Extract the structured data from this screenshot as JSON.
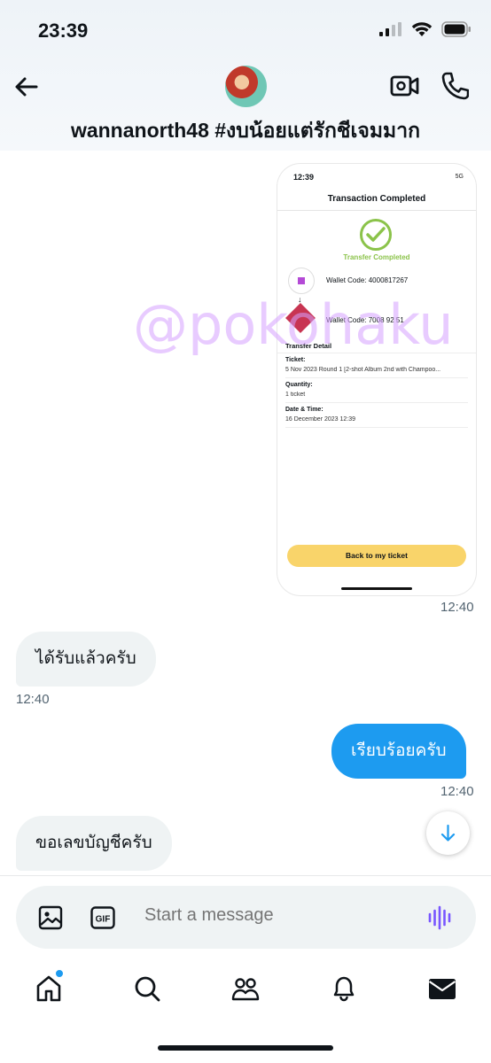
{
  "status_bar": {
    "time": "23:39"
  },
  "header": {
    "title": "wannanorth48 #งบน้อยแต่รักชีเจมมาก",
    "icons": {
      "back": "arrow-left-icon",
      "video": "video-call-icon",
      "call": "phone-icon"
    }
  },
  "shared_image": {
    "status_time": "12:39",
    "status_network": "5G",
    "title": "Transaction Completed",
    "completed_label": "Transfer Completed",
    "wallet_from": "Wallet Code: 4000817267",
    "arrow": "↓",
    "wallet_to": "Wallet Code: 7008 92 51",
    "detail_heading": "Transfer Detail",
    "ticket_label": "Ticket:",
    "ticket_value": "5 Nov 2023 Round 1 [2-shot Album 2nd with Champoo...",
    "quantity_label": "Quantity:",
    "quantity_value": "1 ticket",
    "datetime_label": "Date & Time:",
    "datetime_value": "16 December 2023 12:39",
    "button_label": "Back to my ticket",
    "timestamp": "12:40"
  },
  "watermark": "@pokohaku",
  "messages": [
    {
      "direction": "incoming",
      "text": "ได้รับแล้วครับ",
      "time": "12:40"
    },
    {
      "direction": "outgoing",
      "text": "เรียบร้อยครับ",
      "time": "12:40"
    },
    {
      "direction": "incoming",
      "text": "ขอเลขบัญชีครับ",
      "time": ""
    }
  ],
  "composer": {
    "placeholder": "Start a message",
    "icons": {
      "image": "image-icon",
      "gif": "gif-icon",
      "voice": "voice-wave-icon"
    },
    "gif_text": "GIF"
  },
  "bottom_nav": [
    {
      "icon": "home-icon",
      "badge": true
    },
    {
      "icon": "search-icon",
      "badge": false
    },
    {
      "icon": "communities-icon",
      "badge": false
    },
    {
      "icon": "notifications-icon",
      "badge": false
    },
    {
      "icon": "messages-icon",
      "badge": false
    }
  ],
  "colors": {
    "accent": "#1d9bf0",
    "voice": "#7856ff",
    "button_yellow": "#f9d46a",
    "success": "#8bc34a"
  }
}
